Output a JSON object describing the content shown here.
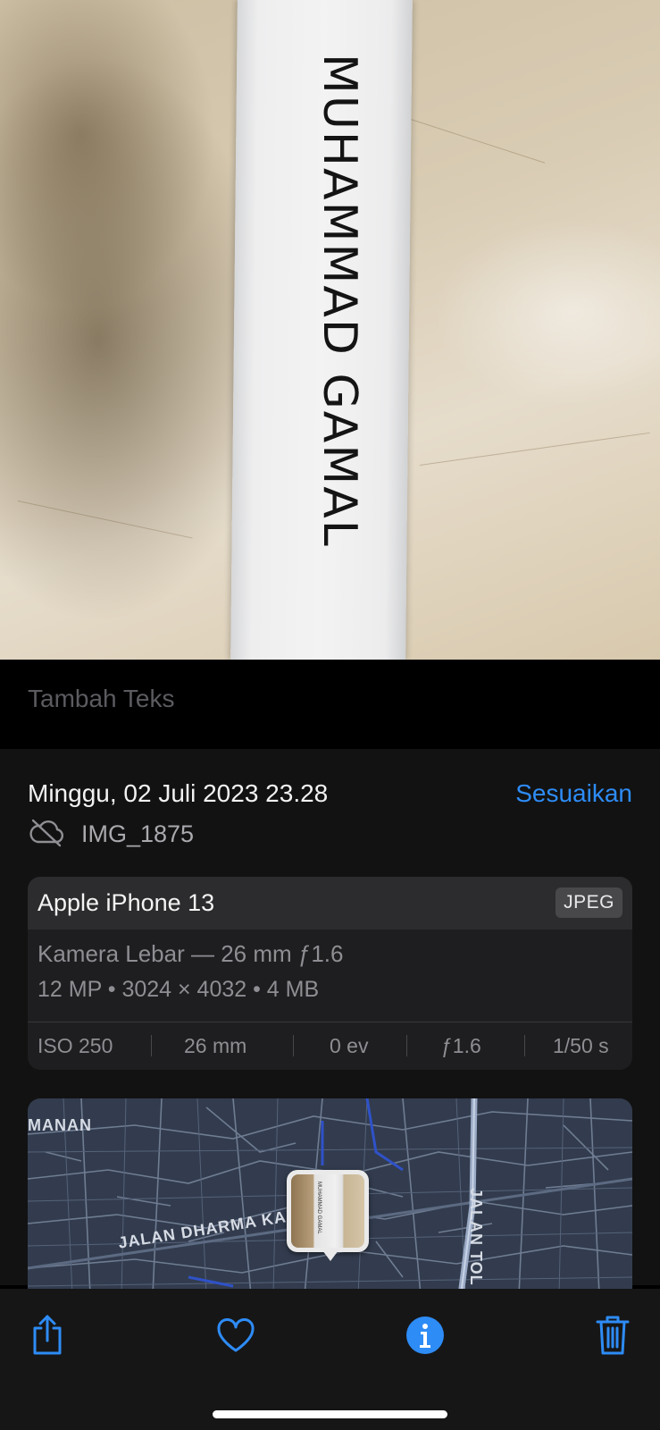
{
  "photo": {
    "handwriting": "MUHAMMAD GAMAL"
  },
  "caption": {
    "placeholder": "Tambah Teks"
  },
  "info": {
    "date": "Minggu, 02 Juli 2023 23.28",
    "adjust_label": "Sesuaikan",
    "file_name": "IMG_1875",
    "cloud_icon": "cloud-slash-icon"
  },
  "camera": {
    "device": "Apple iPhone 13",
    "format": "JPEG",
    "lens": "Kamera Lebar — 26 mm ƒ1.6",
    "specs": "12 MP  •  3024 × 4032  •  4 MB",
    "exif": [
      "ISO 250",
      "26 mm",
      "0 ev",
      "ƒ1.6",
      "1/50 s"
    ]
  },
  "map": {
    "labels": [
      "MANAN",
      "JALAN DHARMA KARYA",
      "JALAN TOL"
    ],
    "background_color": "#323c4e"
  },
  "toolbar": {
    "items": [
      "share-icon",
      "heart-icon",
      "info-icon",
      "trash-icon"
    ],
    "accent_color": "#2e8cf6"
  }
}
